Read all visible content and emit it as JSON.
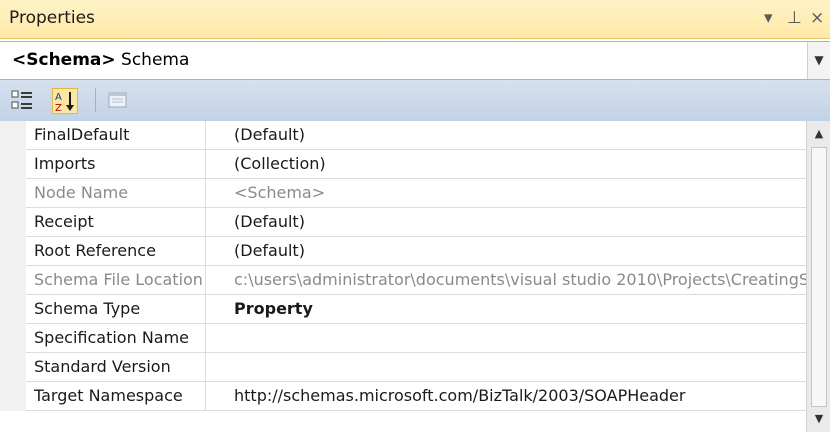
{
  "window": {
    "title": "Properties",
    "controls": {
      "dropdown": "▾",
      "pin": "⊥",
      "close": "×"
    }
  },
  "object_selector": {
    "tag": "<Schema>",
    "name": "Schema"
  },
  "toolbar": {
    "categorized_icon": "categorized-icon",
    "alphabetical_icon": "alphabetical-icon",
    "property_pages_icon": "property-pages-icon"
  },
  "grid": {
    "rows": [
      {
        "name": "FinalDefault",
        "value": "(Default)",
        "readonly": false,
        "bold": false
      },
      {
        "name": "Imports",
        "value": "(Collection)",
        "readonly": false,
        "bold": false
      },
      {
        "name": "Node Name",
        "value": "<Schema>",
        "readonly": true,
        "bold": false
      },
      {
        "name": "Receipt",
        "value": "(Default)",
        "readonly": false,
        "bold": false
      },
      {
        "name": "Root Reference",
        "value": "(Default)",
        "readonly": false,
        "bold": false
      },
      {
        "name": "Schema File Location",
        "value": "c:\\users\\administrator\\documents\\visual studio 2010\\Projects\\CreatingS",
        "readonly": true,
        "bold": false
      },
      {
        "name": "Schema Type",
        "value": "Property",
        "readonly": false,
        "bold": true
      },
      {
        "name": "Specification Name",
        "value": "",
        "readonly": false,
        "bold": false
      },
      {
        "name": "Standard Version",
        "value": "",
        "readonly": false,
        "bold": false
      },
      {
        "name": "Target Namespace",
        "value": "http://schemas.microsoft.com/BizTalk/2003/SOAPHeader",
        "readonly": false,
        "bold": false
      }
    ]
  }
}
